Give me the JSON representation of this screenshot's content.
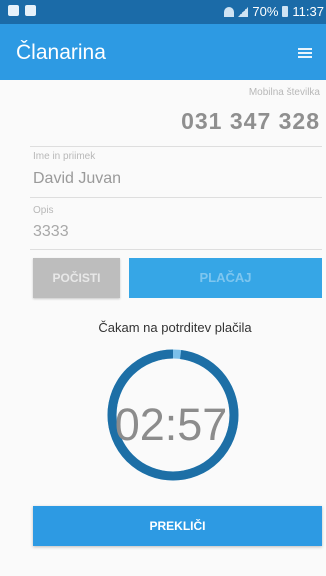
{
  "status_bar": {
    "battery": "70%",
    "time": "11:37"
  },
  "app_bar": {
    "title": "Članarina"
  },
  "form": {
    "phone": {
      "label": "Mobilna številka",
      "value": "031 347 328"
    },
    "name": {
      "label": "Ime in priimek",
      "value": "David Juvan"
    },
    "description": {
      "label": "Opis",
      "value": "3333"
    }
  },
  "buttons": {
    "clear": "POČISTI",
    "pay": "PLAČAJ",
    "cancel": "PREKLIČI"
  },
  "status_text": "Čakam na potrditev plačila",
  "timer": {
    "remaining": "02:57",
    "progress": 0.98
  },
  "colors": {
    "primary": "#2d9ae3",
    "status_bar": "#1b6ba8",
    "ring": "#1d6fa6"
  }
}
